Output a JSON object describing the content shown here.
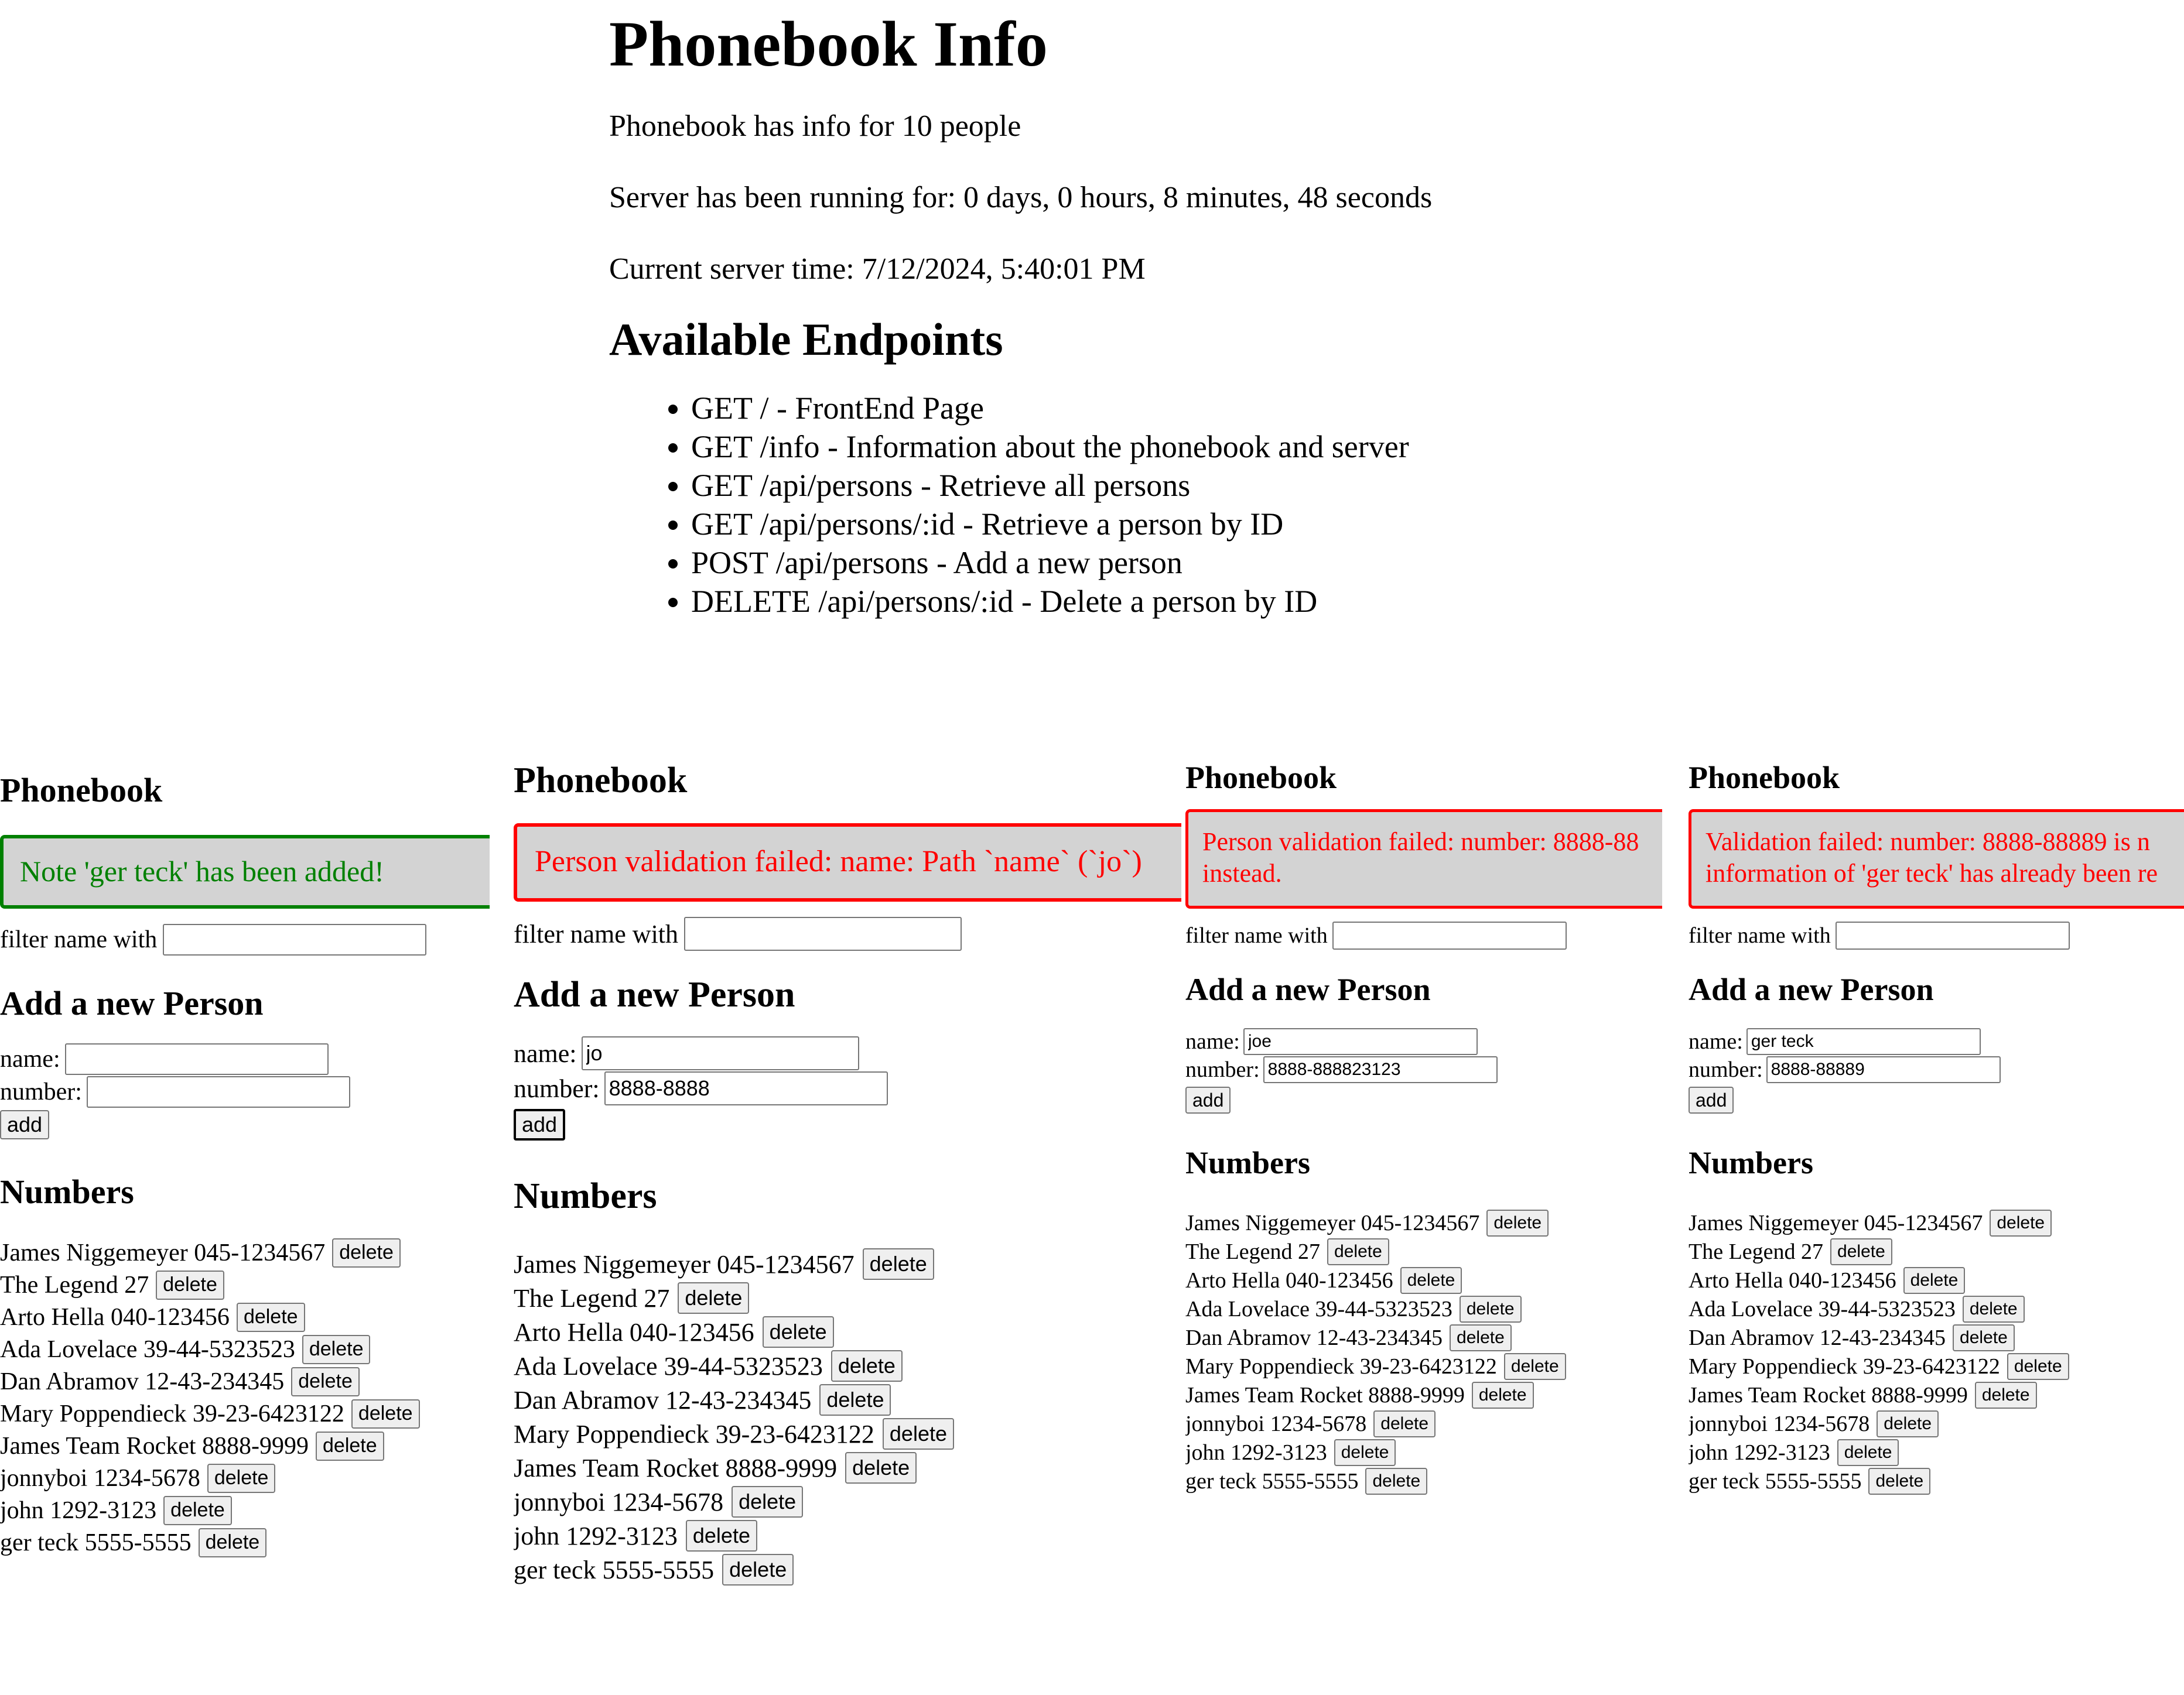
{
  "info": {
    "title": "Phonebook Info",
    "people_count": "Phonebook has info for 10 people",
    "uptime": "Server has been running for: 0 days, 0 hours, 8 minutes, 48 seconds",
    "server_time": "Current server time: 7/12/2024, 5:40:01 PM",
    "endpoints_title": "Available Endpoints",
    "endpoints": [
      "GET / - FrontEnd Page",
      "GET /info - Information about the phonebook and server",
      "GET /api/persons - Retrieve all persons",
      "GET /api/persons/:id - Retrieve a person by ID",
      "POST /api/persons - Add a new person",
      "DELETE /api/persons/:id - Delete a person by ID"
    ]
  },
  "labels": {
    "title": "Phonebook",
    "filter_label": "filter name with",
    "add_title": "Add a new Person",
    "name_label": "name:",
    "number_label": "number:",
    "add_button": "add",
    "numbers_title": "Numbers",
    "delete_button": "delete"
  },
  "colors": {
    "success": "#008000",
    "error": "#ff0000",
    "notification_bg": "#d3d3d3"
  },
  "panels": [
    {
      "notification": {
        "type": "success",
        "message": "Note 'ger teck' has been added!"
      },
      "filter_value": "",
      "name_value": "",
      "number_value": ""
    },
    {
      "notification": {
        "type": "error",
        "message": "Person validation failed: name: Path `name` (`jo`)"
      },
      "filter_value": "",
      "name_value": "jo",
      "number_value": "8888-8888"
    },
    {
      "notification": {
        "type": "error",
        "message": "Person validation failed: number: 8888-88 instead."
      },
      "filter_value": "",
      "name_value": "joe",
      "number_value": "8888-888823123"
    },
    {
      "notification": {
        "type": "error",
        "message": "Validation failed: number: 8888-88889 is n information of 'ger teck' has already been re"
      },
      "filter_value": "",
      "name_value": "ger teck",
      "number_value": "8888-88889"
    }
  ],
  "persons": [
    {
      "entry": "James Niggemeyer 045-1234567"
    },
    {
      "entry": "The Legend 27"
    },
    {
      "entry": "Arto Hella 040-123456"
    },
    {
      "entry": "Ada Lovelace 39-44-5323523"
    },
    {
      "entry": "Dan Abramov 12-43-234345"
    },
    {
      "entry": "Mary Poppendieck 39-23-6423122"
    },
    {
      "entry": "James Team Rocket 8888-9999"
    },
    {
      "entry": "jonnyboi 1234-5678"
    },
    {
      "entry": "john 1292-3123"
    },
    {
      "entry": "ger teck 5555-5555"
    }
  ]
}
